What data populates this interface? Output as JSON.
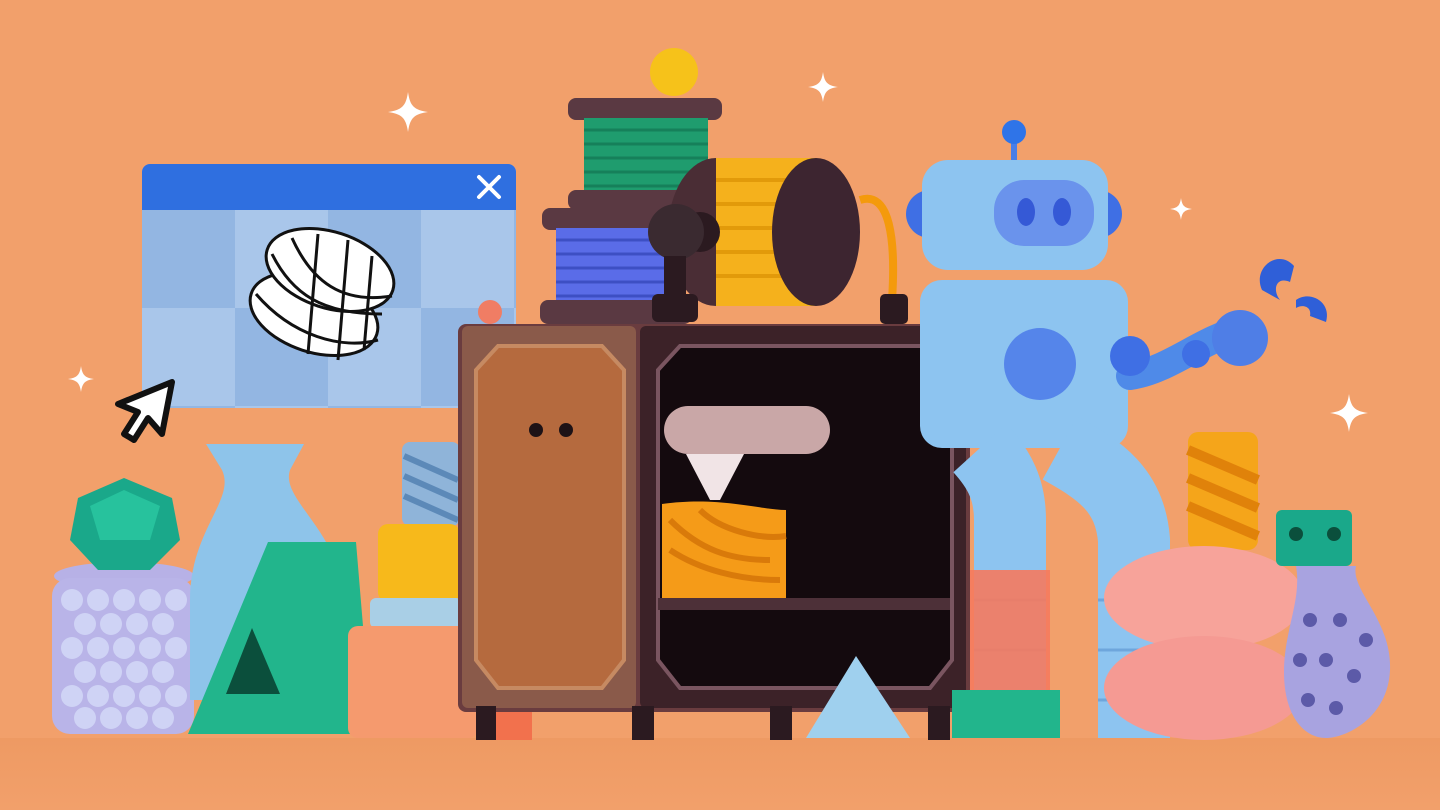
{
  "scene": {
    "background_color": "#f2a06b",
    "window_accent": "#2f6fe0",
    "objects": [
      "3d-model-window",
      "cursor-icon",
      "filament-spools",
      "3d-printer",
      "robot",
      "printed-vases",
      "sparkle-icon"
    ]
  }
}
